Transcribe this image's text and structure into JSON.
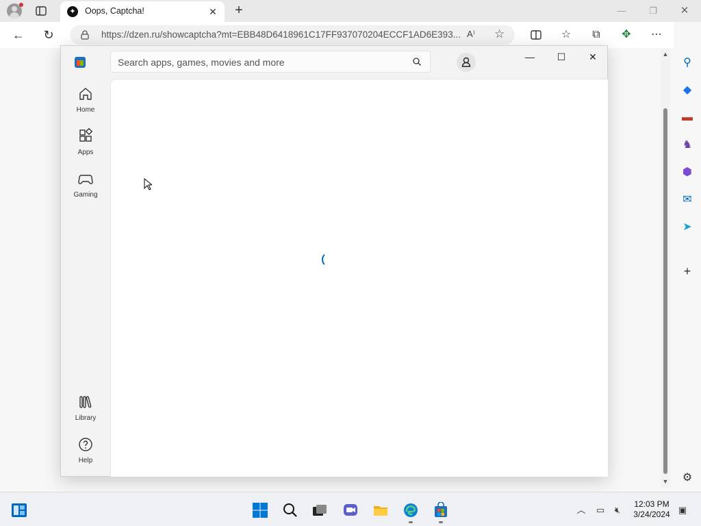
{
  "browser": {
    "tab_title": "Oops, Captcha!",
    "url": "https://dzen.ru/showcaptcha?mt=EBB48D6418961C17FF937070204ECCF1AD6E393...",
    "read_aloud": "A⁾",
    "accent": "#0067c0"
  },
  "store": {
    "search_placeholder": "Search apps, games, movies and more",
    "nav": [
      {
        "label": "Home",
        "icon": "home-icon"
      },
      {
        "label": "Apps",
        "icon": "apps-icon"
      },
      {
        "label": "Gaming",
        "icon": "gaming-icon"
      }
    ],
    "nav_bottom": [
      {
        "label": "Library",
        "icon": "library-icon"
      },
      {
        "label": "Help",
        "icon": "help-icon"
      }
    ]
  },
  "taskbar": {
    "time": "12:03 PM",
    "date": "3/24/2024"
  }
}
